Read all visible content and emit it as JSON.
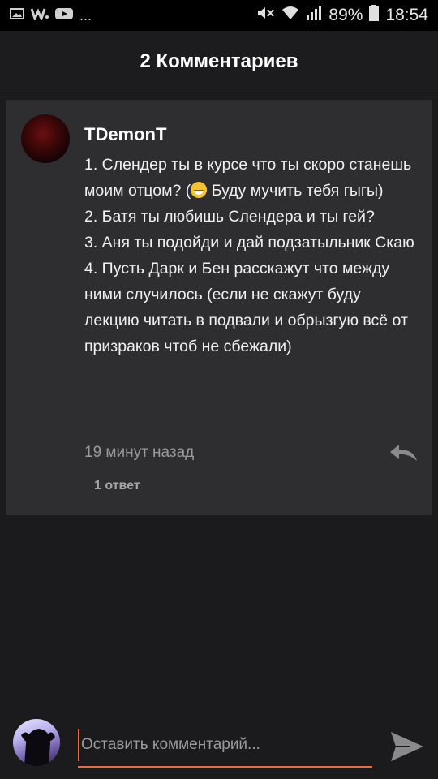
{
  "status_bar": {
    "notification_icons": [
      "image-icon",
      "w-app-icon",
      "youtube-icon"
    ],
    "more_indicator": "...",
    "battery": "89%",
    "time": "18:54"
  },
  "header": {
    "title": "2 Комментариев"
  },
  "comment": {
    "author": "TDemonT",
    "lines": [
      "1. Слендер ты в курсе что ты скоро станешь моим отцом? (",
      " Буду мучить тебя гыгы)",
      "2. Батя ты любишь Слендера и ты гей?",
      "3. Аня ты подойди и дай подзатыльник Скаю",
      "4. Пусть Дарк и Бен расскажут что между ними случилось (если не скажут буду лекцию читать в подвали и обрызгую всё от призраков чтоб не сбежали)"
    ],
    "emoji": "grinning-face-icon",
    "timestamp": "19 минут назад",
    "replies": "1 ответ"
  },
  "composer": {
    "placeholder": "Оставить комментарий..."
  },
  "colors": {
    "background": "#1b1a1c",
    "card": "#2e2d30",
    "accent": "#f2683a",
    "muted_text": "#9a999c"
  }
}
